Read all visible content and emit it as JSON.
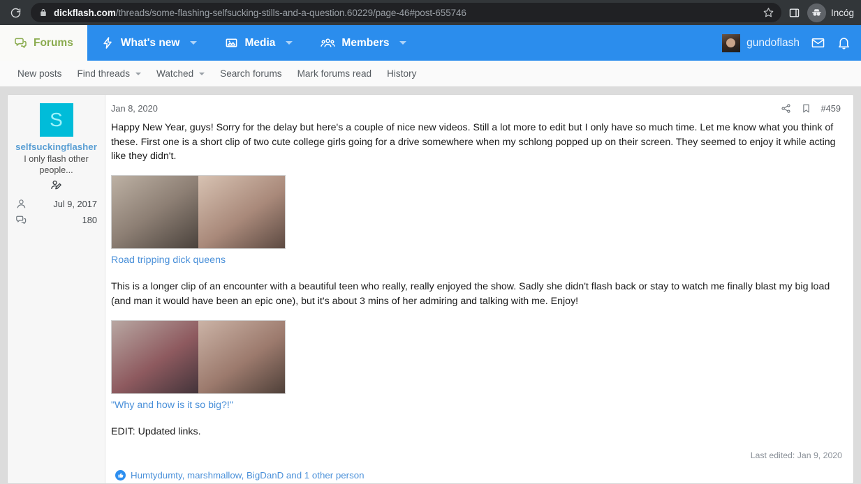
{
  "browser": {
    "reload_icon": "reload-icon",
    "lock_icon": "lock-icon",
    "url_domain": "dickflash.com",
    "url_path": "/threads/some-flashing-selfsucking-stills-and-a-question.60229/page-46#post-655746",
    "star_icon": "star-icon",
    "panel_icon": "side-panel-icon",
    "incognito_label": "Incóg",
    "incognito_icon": "incognito-avatar-icon"
  },
  "site_nav": {
    "tabs": [
      {
        "label": "Forums",
        "icon": "forums-icon",
        "active": true,
        "has_caret": false
      },
      {
        "label": "What's new",
        "icon": "lightning-icon",
        "active": false,
        "has_caret": true
      },
      {
        "label": "Media",
        "icon": "image-icon",
        "active": false,
        "has_caret": true
      },
      {
        "label": "Members",
        "icon": "members-icon",
        "active": false,
        "has_caret": true
      }
    ],
    "user": {
      "name": "gundoflash",
      "avatar_icon": "user-avatar"
    },
    "inbox_icon": "envelope-icon",
    "alerts_icon": "bell-icon"
  },
  "sub_nav": {
    "items": [
      {
        "label": "New posts",
        "has_caret": false
      },
      {
        "label": "Find threads",
        "has_caret": true
      },
      {
        "label": "Watched",
        "has_caret": true
      },
      {
        "label": "Search forums",
        "has_caret": false
      },
      {
        "label": "Mark forums read",
        "has_caret": false
      },
      {
        "label": "History",
        "has_caret": false
      }
    ]
  },
  "post": {
    "author": {
      "avatar_letter": "S",
      "avatar_color": "#00bcd9",
      "username": "selfsuckingflasher",
      "user_title": "I only flash other people...",
      "badge_icon": "user-edit-icon",
      "joined_icon": "person-icon",
      "joined_date": "Jul 9, 2017",
      "messages_icon": "comments-icon",
      "messages_count": "180"
    },
    "date": "Jan 8, 2020",
    "share_icon": "share-icon",
    "bookmark_icon": "bookmark-icon",
    "post_number": "#459",
    "paragraph_1": "Happy New Year, guys! Sorry for the delay but here's a couple of nice new videos. Still a lot more to edit but I only have so much time. Let me know what you think of these. First one is a short clip of two cute college girls going for a drive somewhere when my schlong popped up on their screen. They seemed to enjoy it while acting like they didn't.",
    "media_1_caption": "Road tripping dick queens",
    "paragraph_2": "This is a longer clip of an encounter with a beautiful teen who really, really enjoyed the show. Sadly she didn't flash back or stay to watch me finally blast my big load (and man it would have been an epic one), but it's about 3 mins of her admiring and talking with me. Enjoy!",
    "media_2_caption": "\"Why and how is it so big?!\"",
    "paragraph_3": "EDIT: Updated links.",
    "last_edited": "Last edited: Jan 9, 2020",
    "reactions_icon": "thumbs-up-icon",
    "reactions_text": "Humtydumty, marshmallow, BigDanD and 1 other person"
  },
  "colors": {
    "nav_blue": "#2b8ded",
    "active_tab_green": "#8aab4e",
    "link_blue": "#4a90d9",
    "avatar_cyan": "#00bcd9",
    "page_gray": "#dcdcdc"
  }
}
